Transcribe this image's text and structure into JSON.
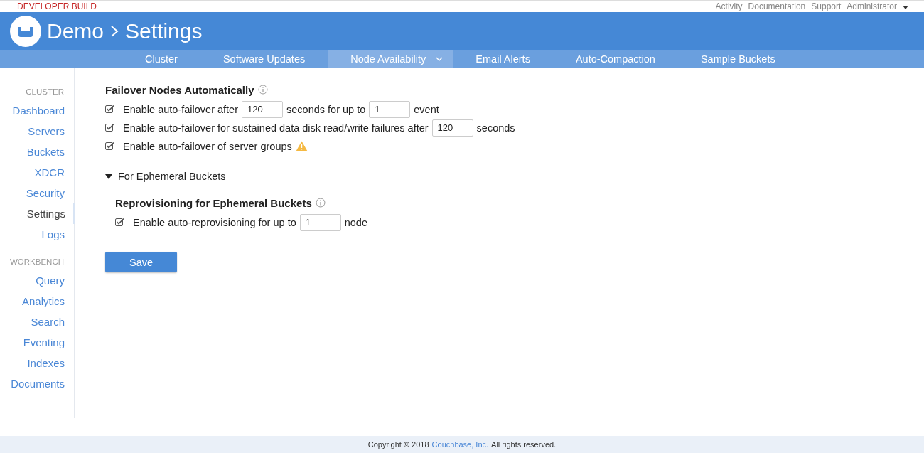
{
  "top_bar": {
    "build_label": "DEVELOPER BUILD",
    "links": [
      "Activity",
      "Documentation",
      "Support"
    ],
    "user_menu": "Administrator"
  },
  "header": {
    "breadcrumb": [
      "Demo",
      "Settings"
    ]
  },
  "tabs": [
    {
      "label": "Cluster",
      "selected": false,
      "has_menu": false
    },
    {
      "label": "Software Updates",
      "selected": false,
      "has_menu": false
    },
    {
      "label": "Node Availability",
      "selected": true,
      "has_menu": true
    },
    {
      "label": "Email Alerts",
      "selected": false,
      "has_menu": false
    },
    {
      "label": "Auto-Compaction",
      "selected": false,
      "has_menu": false
    },
    {
      "label": "Sample Buckets",
      "selected": false,
      "has_menu": false
    }
  ],
  "sidebar": {
    "sections": [
      {
        "heading": "CLUSTER",
        "items": [
          {
            "label": "Dashboard",
            "selected": false
          },
          {
            "label": "Servers",
            "selected": false
          },
          {
            "label": "Buckets",
            "selected": false
          },
          {
            "label": "XDCR",
            "selected": false
          },
          {
            "label": "Security",
            "selected": false
          },
          {
            "label": "Settings",
            "selected": true
          },
          {
            "label": "Logs",
            "selected": false
          }
        ]
      },
      {
        "heading": "WORKBENCH",
        "items": [
          {
            "label": "Query",
            "selected": false
          },
          {
            "label": "Analytics",
            "selected": false
          },
          {
            "label": "Search",
            "selected": false
          },
          {
            "label": "Eventing",
            "selected": false
          },
          {
            "label": "Indexes",
            "selected": false
          },
          {
            "label": "Documents",
            "selected": false
          }
        ]
      }
    ]
  },
  "failover": {
    "title": "Failover Nodes Automatically",
    "options": [
      {
        "checked": true,
        "parts": [
          {
            "kind": "text",
            "text": "Enable auto-failover after"
          },
          {
            "kind": "input",
            "value": "120"
          },
          {
            "kind": "text",
            "text": "seconds for up to"
          },
          {
            "kind": "input",
            "value": "1"
          },
          {
            "kind": "text",
            "text": "event"
          }
        ]
      },
      {
        "checked": true,
        "parts": [
          {
            "kind": "text",
            "text": "Enable auto-failover for sustained data disk read/write failures after"
          },
          {
            "kind": "input",
            "value": "120"
          },
          {
            "kind": "text",
            "text": "seconds"
          }
        ]
      },
      {
        "checked": true,
        "parts": [
          {
            "kind": "text",
            "text": "Enable auto-failover of server groups"
          },
          {
            "kind": "warning"
          }
        ]
      }
    ]
  },
  "ephemeral": {
    "label": "For Ephemeral Buckets",
    "expanded": true,
    "title": "Reprovisioning for Ephemeral Buckets",
    "options": [
      {
        "checked": true,
        "parts": [
          {
            "kind": "text",
            "text": "Enable auto-reprovisioning for up to"
          },
          {
            "kind": "input",
            "value": "1"
          },
          {
            "kind": "text",
            "text": "node"
          }
        ]
      }
    ]
  },
  "save_button": "Save",
  "footer": {
    "prefix": "Copyright © 2018",
    "link": "Couchbase, Inc.",
    "suffix": "All rights reserved."
  }
}
